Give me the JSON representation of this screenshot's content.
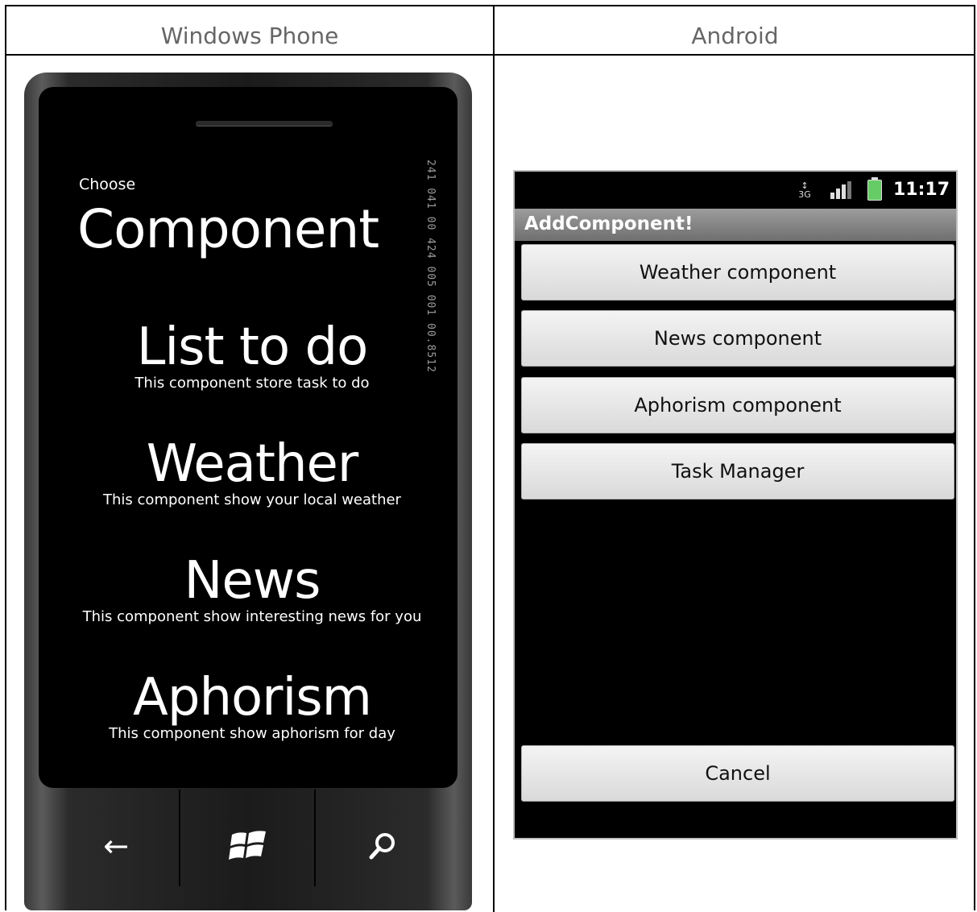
{
  "headers": {
    "wp": "Windows Phone",
    "android": "Android"
  },
  "wp": {
    "small_title": "Choose",
    "page_title": "Component",
    "counter": "241 041 00 424 005 001 00.8512",
    "items": [
      {
        "title": "List to do",
        "desc": "This component store task to do"
      },
      {
        "title": "Weather",
        "desc": "This component show your local weather"
      },
      {
        "title": "News",
        "desc": "This component show interesting news for you"
      },
      {
        "title": "Aphorism",
        "desc": "This component show aphorism for day"
      }
    ],
    "hw_back": "←",
    "hw_search": "⌕"
  },
  "android": {
    "clock": "11:17",
    "net_type": "3G",
    "app_title": "AddComponent!",
    "buttons": [
      "Weather component",
      "News component",
      "Aphorism component",
      "Task Manager"
    ],
    "cancel": "Cancel",
    "accent": "#6c6c6c"
  }
}
